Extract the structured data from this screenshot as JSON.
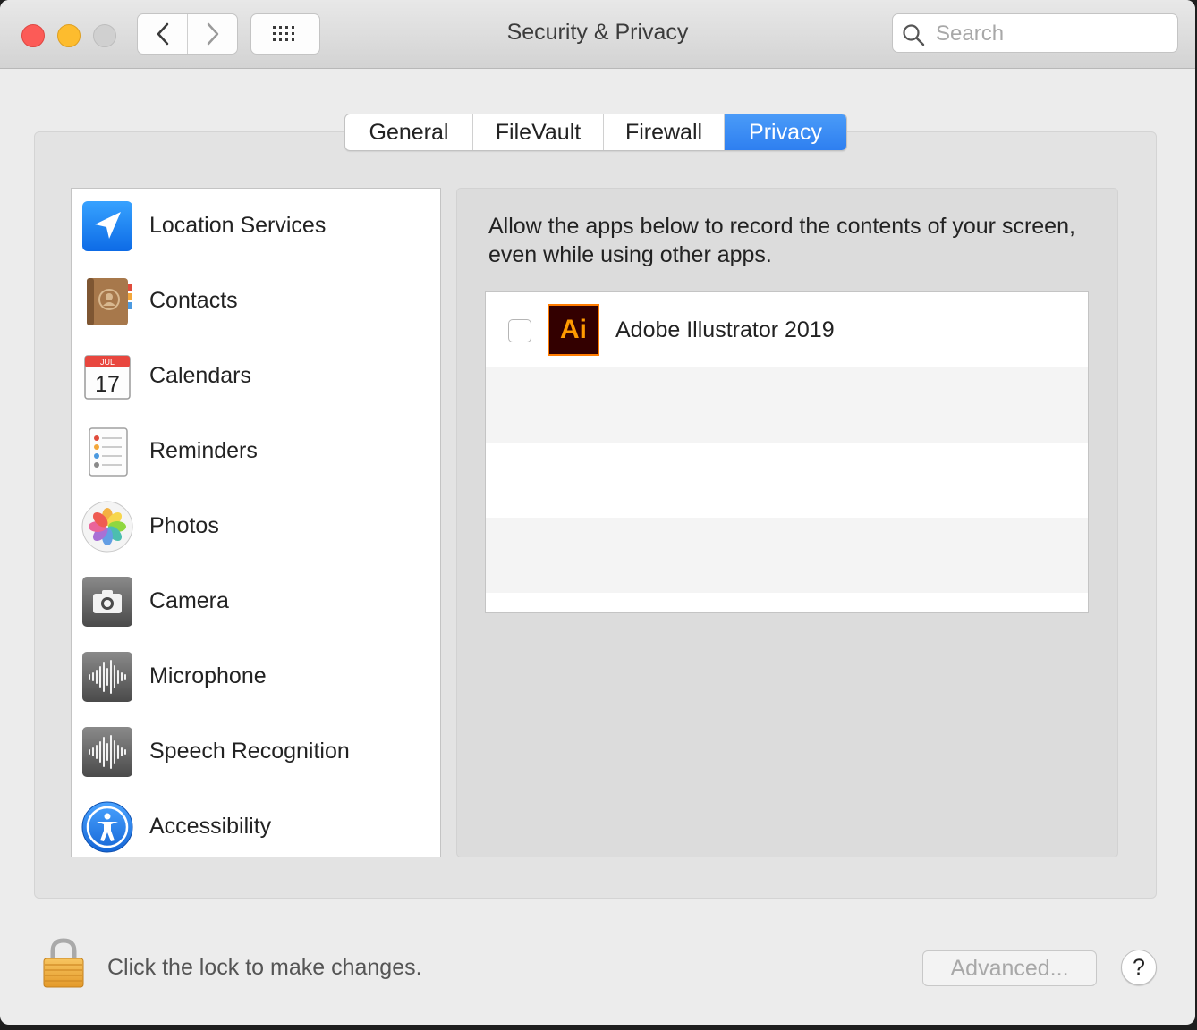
{
  "window": {
    "title": "Security & Privacy"
  },
  "toolbar": {
    "back_icon": "chevron-left-icon",
    "forward_icon": "chevron-right-icon",
    "grid_icon": "show-all-grid-icon",
    "search": {
      "placeholder": "Search",
      "value": ""
    }
  },
  "tabs": [
    {
      "label": "General",
      "active": false
    },
    {
      "label": "FileVault",
      "active": false
    },
    {
      "label": "Firewall",
      "active": false
    },
    {
      "label": "Privacy",
      "active": true
    }
  ],
  "sidebar": {
    "items": [
      {
        "label": "Location Services",
        "icon": "location-arrow-icon"
      },
      {
        "label": "Contacts",
        "icon": "contacts-book-icon"
      },
      {
        "label": "Calendars",
        "icon": "calendar-icon",
        "icon_month": "JUL",
        "icon_day": "17"
      },
      {
        "label": "Reminders",
        "icon": "reminders-icon"
      },
      {
        "label": "Photos",
        "icon": "photos-flower-icon"
      },
      {
        "label": "Camera",
        "icon": "camera-icon"
      },
      {
        "label": "Microphone",
        "icon": "waveform-icon"
      },
      {
        "label": "Speech Recognition",
        "icon": "waveform-icon"
      },
      {
        "label": "Accessibility",
        "icon": "accessibility-icon"
      }
    ]
  },
  "main": {
    "description": "Allow the apps below to record the contents of your screen, even while using other apps.",
    "apps": [
      {
        "name": "Adobe Illustrator 2019",
        "icon_text": "Ai",
        "checked": false
      }
    ]
  },
  "footer": {
    "lock_text": "Click the lock to make changes.",
    "advanced_label": "Advanced...",
    "help_label": "?"
  },
  "colors": {
    "accent": "#2e7ff0",
    "close": "#fc5b57",
    "minimize": "#fdbc2e",
    "zoom_disabled": "#d0d0d0",
    "illustrator_orange": "#ff9a00",
    "illustrator_bg": "#330000"
  }
}
